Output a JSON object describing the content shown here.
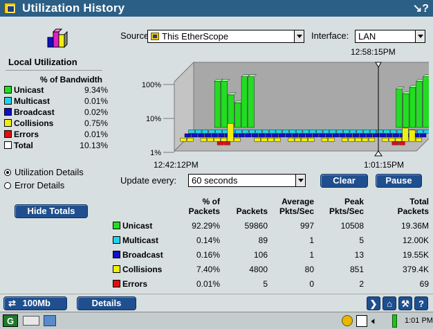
{
  "window": {
    "title": "Utilization History",
    "help_glyph": "↘?"
  },
  "left_panel": {
    "heading": "Local Utilization",
    "subheading": "% of Bandwidth",
    "legend": [
      {
        "name": "Unicast",
        "value": "9.34%",
        "color": "#22dd22"
      },
      {
        "name": "Multicast",
        "value": "0.01%",
        "color": "#22d4e8"
      },
      {
        "name": "Broadcast",
        "value": "0.02%",
        "color": "#1010c8"
      },
      {
        "name": "Collisions",
        "value": "0.75%",
        "color": "#f0ee10"
      },
      {
        "name": "Errors",
        "value": "0.01%",
        "color": "#e01010"
      },
      {
        "name": "Total",
        "value": "10.13%",
        "color": "#ffffff"
      }
    ],
    "radio_options": [
      {
        "label": "Utilization Details",
        "selected": true
      },
      {
        "label": "Error Details",
        "selected": false
      }
    ],
    "hide_totals_label": "Hide Totals"
  },
  "controls": {
    "source_label": "Source:",
    "source_value": "This EtherScope",
    "interface_label": "Interface:",
    "interface_value": "LAN",
    "update_label": "Update every:",
    "update_value": "60 seconds",
    "clear_label": "Clear",
    "pause_label": "Pause"
  },
  "chart_data": {
    "type": "bar",
    "y_ticks": [
      "100%",
      "10%",
      "1%"
    ],
    "log_scale": true,
    "cursor_time": "12:58:15PM",
    "x_start": "12:42:12PM",
    "x_end": "1:01:15PM",
    "series": [
      {
        "name": "Unicast",
        "color": "#22dd22",
        "values": [
          0,
          0,
          0,
          60,
          60,
          18,
          9,
          90,
          90,
          0,
          0,
          0,
          0,
          0,
          0,
          0,
          0,
          0,
          0,
          0,
          0,
          0,
          0,
          0,
          0,
          0,
          0,
          0,
          0,
          0,
          30,
          20,
          35,
          60,
          90,
          30
        ]
      },
      {
        "name": "Multicast",
        "color": "#22d4e8",
        "values": [
          1,
          1,
          1,
          1,
          1,
          1,
          1,
          1,
          1,
          1,
          1,
          1,
          1,
          1,
          1,
          1,
          1,
          1,
          1,
          1,
          1,
          1,
          1,
          1,
          1,
          1,
          1,
          1,
          1,
          1,
          1,
          1,
          1,
          1,
          1,
          1
        ]
      },
      {
        "name": "Broadcast",
        "color": "#1010c8",
        "values": [
          1,
          1,
          1,
          1,
          1,
          1,
          1,
          1,
          1,
          1,
          1,
          1,
          1,
          1,
          1,
          1,
          1,
          1,
          1,
          1,
          1,
          1,
          1,
          1,
          1,
          1,
          1,
          1,
          1,
          1,
          1,
          1,
          1,
          1,
          1,
          1
        ]
      },
      {
        "name": "Collisions",
        "color": "#f0ee10",
        "values": [
          1,
          1,
          0,
          1,
          1,
          1,
          1,
          8,
          1,
          0,
          0,
          1,
          1,
          1,
          1,
          0,
          1,
          1,
          1,
          1,
          0,
          1,
          1,
          0,
          1,
          1,
          1,
          1,
          1,
          0,
          1,
          1,
          1,
          4,
          3,
          1
        ]
      },
      {
        "name": "Errors",
        "color": "#e01010",
        "values": [
          0,
          0,
          0,
          0,
          0,
          0,
          1,
          1,
          0,
          0,
          0,
          0,
          0,
          0,
          0,
          0,
          0,
          0,
          0,
          0,
          0,
          0,
          0,
          0,
          0,
          0,
          0,
          0,
          0,
          0,
          0,
          0,
          1,
          1,
          0,
          0
        ]
      }
    ]
  },
  "table": {
    "headers": [
      {
        "l1": "% of",
        "l2": "Packets"
      },
      {
        "l1": "",
        "l2": "Packets"
      },
      {
        "l1": "Average",
        "l2": "Pkts/Sec"
      },
      {
        "l1": "Peak",
        "l2": "Pkts/Sec"
      },
      {
        "l1": "Total",
        "l2": "Packets"
      }
    ],
    "rows": [
      {
        "name": "Unicast",
        "color": "#22dd22",
        "cells": [
          "92.29%",
          "59860",
          "997",
          "10508",
          "19.36M"
        ]
      },
      {
        "name": "Multicast",
        "color": "#22d4e8",
        "cells": [
          "0.14%",
          "89",
          "1",
          "5",
          "12.00K"
        ]
      },
      {
        "name": "Broadcast",
        "color": "#1010c8",
        "cells": [
          "0.16%",
          "106",
          "1",
          "13",
          "19.55K"
        ]
      },
      {
        "name": "Collisions",
        "color": "#f0ee10",
        "cells": [
          "7.40%",
          "4800",
          "80",
          "851",
          "379.4K"
        ]
      },
      {
        "name": "Errors",
        "color": "#e01010",
        "cells": [
          "0.01%",
          "5",
          "0",
          "2",
          "69"
        ]
      }
    ]
  },
  "bottom_bar": {
    "speed_label": "100Mb",
    "details_label": "Details"
  },
  "taskbar": {
    "clock": "1:01 PM"
  }
}
